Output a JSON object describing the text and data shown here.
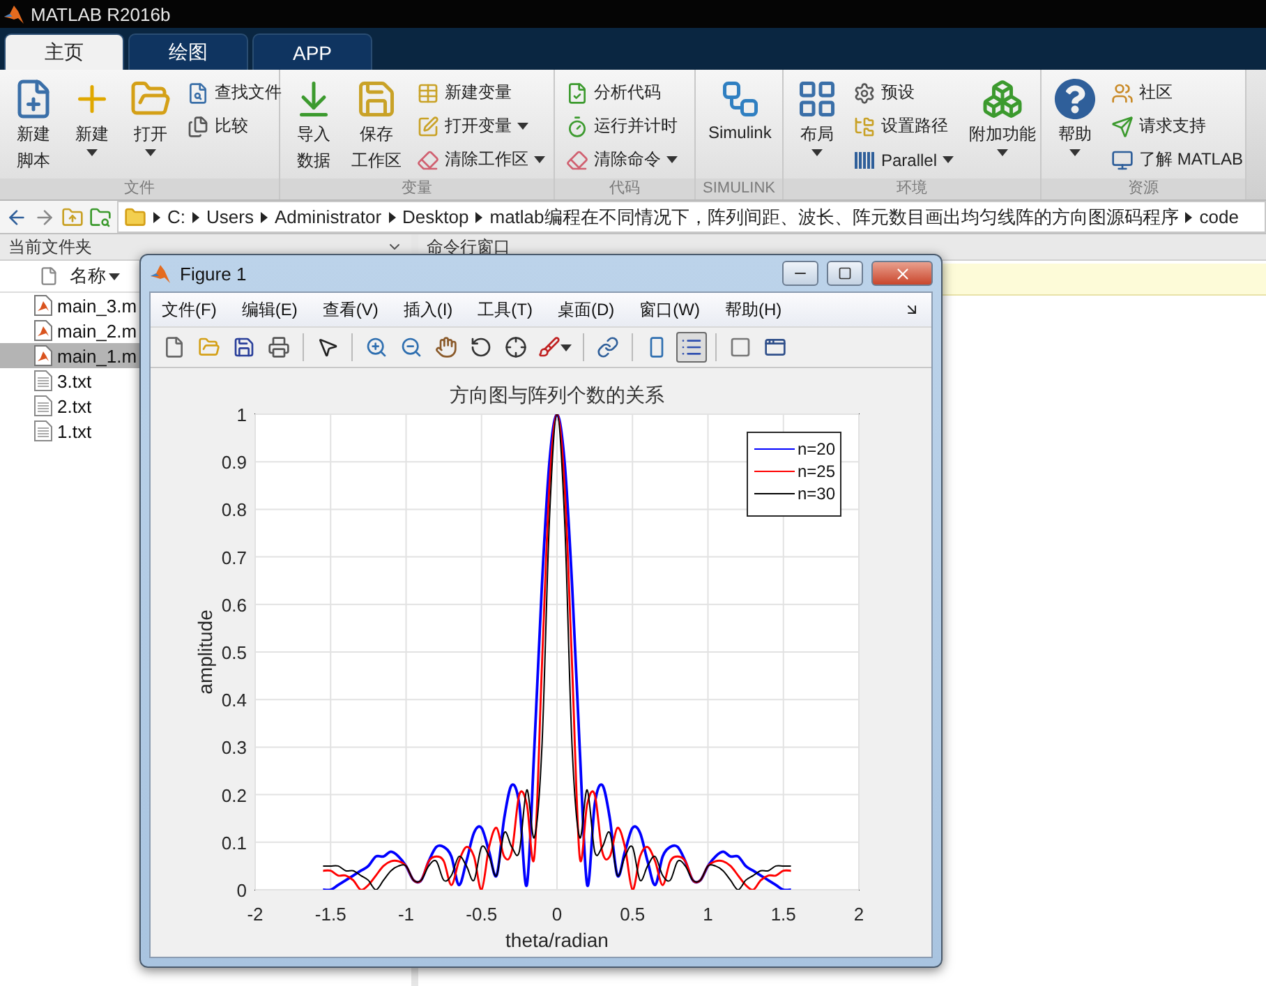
{
  "app": {
    "title": "MATLAB R2016b"
  },
  "tabs": [
    {
      "label": "主页",
      "selected": true
    },
    {
      "label": "绘图",
      "selected": false
    },
    {
      "label": "APP",
      "selected": false
    }
  ],
  "toolstrip": [
    {
      "label": "文件",
      "groups": [
        {
          "kind": "large",
          "lines": [
            "新建",
            "脚本"
          ],
          "dropdown": false
        },
        {
          "kind": "large",
          "lines": [
            "新建"
          ],
          "dropdown": true
        },
        {
          "kind": "large",
          "lines": [
            "打开"
          ],
          "dropdown": true
        },
        {
          "kind": "column",
          "items": [
            {
              "label": "查找文件",
              "dropdown": false
            },
            {
              "label": "比较",
              "dropdown": false
            }
          ]
        }
      ]
    },
    {
      "label": "变量",
      "groups": [
        {
          "kind": "large",
          "lines": [
            "导入",
            "数据"
          ],
          "dropdown": false
        },
        {
          "kind": "large",
          "lines": [
            "保存",
            "工作区"
          ],
          "dropdown": false
        },
        {
          "kind": "column",
          "items": [
            {
              "label": "新建变量",
              "dropdown": false
            },
            {
              "label": "打开变量",
              "dropdown": true
            },
            {
              "label": "清除工作区",
              "dropdown": true
            }
          ]
        }
      ]
    },
    {
      "label": "代码",
      "groups": [
        {
          "kind": "column",
          "items": [
            {
              "label": "分析代码",
              "dropdown": false
            },
            {
              "label": "运行并计时",
              "dropdown": false
            },
            {
              "label": "清除命令",
              "dropdown": true
            }
          ]
        }
      ]
    },
    {
      "label": "SIMULINK",
      "groups": [
        {
          "kind": "large",
          "lines": [
            "Simulink"
          ],
          "dropdown": false
        }
      ]
    },
    {
      "label": "环境",
      "groups": [
        {
          "kind": "large",
          "lines": [
            "布局"
          ],
          "dropdown": true
        },
        {
          "kind": "column",
          "items": [
            {
              "label": "预设",
              "dropdown": false
            },
            {
              "label": "设置路径",
              "dropdown": false
            },
            {
              "label": "Parallel",
              "dropdown": true
            }
          ]
        },
        {
          "kind": "large",
          "lines": [
            "附加功能"
          ],
          "dropdown": true
        }
      ]
    },
    {
      "label": "资源",
      "groups": [
        {
          "kind": "large",
          "lines": [
            "帮助"
          ],
          "dropdown": true
        },
        {
          "kind": "column",
          "items": [
            {
              "label": "社区",
              "dropdown": false
            },
            {
              "label": "请求支持",
              "dropdown": false
            },
            {
              "label": "了解 MATLAB",
              "dropdown": false
            }
          ]
        }
      ]
    }
  ],
  "address_bar": {
    "segments": [
      "C:",
      "Users",
      "Administrator",
      "Desktop",
      "matlab编程在不同情况下，阵列间距、波长、阵元数目画出均匀线阵的方向图源码程序",
      "code"
    ]
  },
  "current_folder": {
    "title": "当前文件夹",
    "column": "名称",
    "files": [
      {
        "name": "main_3.m",
        "kind": "script",
        "selected": false
      },
      {
        "name": "main_2.m",
        "kind": "script",
        "selected": false
      },
      {
        "name": "main_1.m",
        "kind": "script",
        "selected": true
      },
      {
        "name": "3.txt",
        "kind": "text",
        "selected": false
      },
      {
        "name": "2.txt",
        "kind": "text",
        "selected": false
      },
      {
        "name": "1.txt",
        "kind": "text",
        "selected": false
      }
    ]
  },
  "command_window": {
    "title": "命令行窗口"
  },
  "figure": {
    "title": "Figure 1",
    "menus": [
      "文件(F)",
      "编辑(E)",
      "查看(V)",
      "插入(I)",
      "工具(T)",
      "桌面(D)",
      "窗口(W)",
      "帮助(H)"
    ],
    "toolbar": [
      {
        "pressed": false
      },
      {
        "pressed": false
      },
      {
        "pressed": false
      },
      {
        "pressed": false
      },
      {
        "pressed": false
      },
      {
        "pressed": false
      },
      {
        "pressed": false
      },
      {
        "pressed": false
      },
      {
        "pressed": false
      },
      {
        "pressed": false
      },
      {
        "pressed": false
      },
      {
        "pressed": false
      },
      {
        "pressed": false
      },
      {
        "pressed": true
      },
      {
        "pressed": false
      },
      {
        "pressed": false
      }
    ],
    "chart_data": {
      "type": "line",
      "title": "方向图与阵列个数的关系",
      "xlabel": "theta/radian",
      "ylabel": "amplitude",
      "x": [
        -1.55,
        -1.5,
        -1.45,
        -1.4,
        -1.35,
        -1.3,
        -1.25,
        -1.2,
        -1.15,
        -1.1,
        -1.05,
        -1,
        -0.95,
        -0.9,
        -0.85,
        -0.8,
        -0.75,
        -0.7,
        -0.65,
        -0.6,
        -0.55,
        -0.5,
        -0.45,
        -0.4,
        -0.35,
        -0.3,
        -0.25,
        -0.2,
        -0.15,
        -0.1,
        -0.05,
        0,
        0.05,
        0.1,
        0.15,
        0.2,
        0.25,
        0.3,
        0.35,
        0.4,
        0.45,
        0.5,
        0.55,
        0.6,
        0.65,
        0.7,
        0.75,
        0.8,
        0.85,
        0.9,
        0.95,
        1,
        1.05,
        1.1,
        1.15,
        1.2,
        1.25,
        1.3,
        1.35,
        1.4,
        1.45,
        1.5,
        1.55
      ],
      "series": [
        {
          "name": "n=20",
          "color": "#0000ff",
          "values": [
            0,
            0,
            0.01,
            0.02,
            0.03,
            0.04,
            0.05,
            0.07,
            0.07,
            0.08,
            0.07,
            0.05,
            0.02,
            0.02,
            0.06,
            0.09,
            0.09,
            0.07,
            0.01,
            0.06,
            0.12,
            0.13,
            0.08,
            0.03,
            0.15,
            0.22,
            0.18,
            0.01,
            0.3,
            0.64,
            0.9,
            1,
            0.9,
            0.64,
            0.3,
            0.01,
            0.18,
            0.22,
            0.15,
            0.03,
            0.08,
            0.13,
            0.12,
            0.06,
            0.01,
            0.07,
            0.09,
            0.09,
            0.06,
            0.02,
            0.02,
            0.05,
            0.07,
            0.08,
            0.07,
            0.07,
            0.05,
            0.04,
            0.03,
            0.02,
            0.01,
            0,
            0
          ]
        },
        {
          "name": "n=25",
          "color": "#ff0000",
          "values": [
            0.04,
            0.04,
            0.03,
            0.03,
            0.02,
            0,
            0.01,
            0.03,
            0.05,
            0.06,
            0.06,
            0.05,
            0.02,
            0.02,
            0.06,
            0.07,
            0.06,
            0.01,
            0.06,
            0.09,
            0.07,
            0,
            0.09,
            0.13,
            0.07,
            0.08,
            0.2,
            0.18,
            0.07,
            0.47,
            0.85,
            1,
            0.85,
            0.47,
            0.07,
            0.18,
            0.2,
            0.08,
            0.07,
            0.13,
            0.09,
            0,
            0.07,
            0.09,
            0.06,
            0.01,
            0.06,
            0.07,
            0.06,
            0.02,
            0.02,
            0.05,
            0.06,
            0.06,
            0.05,
            0.03,
            0.01,
            0,
            0.02,
            0.03,
            0.03,
            0.04,
            0.04
          ]
        },
        {
          "name": "n=30",
          "color": "#000000",
          "values": [
            0.05,
            0.05,
            0.05,
            0.04,
            0.04,
            0.03,
            0.02,
            0,
            0.02,
            0.04,
            0.05,
            0.05,
            0.02,
            0.02,
            0.05,
            0.06,
            0.02,
            0.03,
            0.07,
            0.05,
            0.02,
            0.09,
            0.07,
            0.03,
            0.12,
            0.09,
            0.08,
            0.21,
            0.11,
            0.3,
            0.78,
            1,
            0.78,
            0.3,
            0.11,
            0.21,
            0.08,
            0.09,
            0.12,
            0.03,
            0.07,
            0.09,
            0.02,
            0.05,
            0.07,
            0.03,
            0.02,
            0.06,
            0.05,
            0.02,
            0.02,
            0.05,
            0.05,
            0.04,
            0.02,
            0,
            0.02,
            0.03,
            0.04,
            0.04,
            0.05,
            0.05,
            0.05
          ]
        }
      ],
      "xlim": [
        -2,
        2
      ],
      "ylim": [
        0,
        1
      ],
      "grid": true,
      "legend": true,
      "xticks": [
        -2,
        -1.5,
        -1,
        -0.5,
        0,
        0.5,
        1,
        1.5,
        2
      ],
      "yticks": [
        0,
        0.1,
        0.2,
        0.3,
        0.4,
        0.5,
        0.6,
        0.7,
        0.8,
        0.9,
        1
      ]
    }
  }
}
